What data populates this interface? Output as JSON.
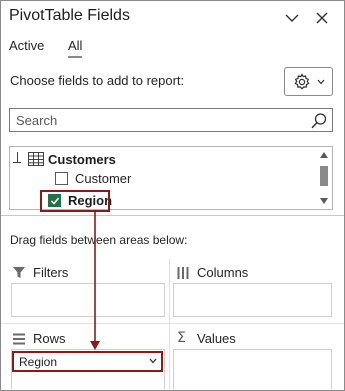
{
  "pane": {
    "title": "PivotTable Fields",
    "tabs": [
      {
        "label": "Active",
        "selected": false
      },
      {
        "label": "All",
        "selected": true
      }
    ],
    "choose_label": "Choose fields to add to report:",
    "search": {
      "placeholder": "Search",
      "value": ""
    },
    "field_list": {
      "table_name": "Customers",
      "fields": [
        {
          "label": "Customer",
          "checked": false
        },
        {
          "label": "Region",
          "checked": true
        }
      ]
    },
    "drag_label": "Drag fields between areas below:",
    "areas": {
      "filters": {
        "label": "Filters"
      },
      "columns": {
        "label": "Columns"
      },
      "rows": {
        "label": "Rows",
        "items": [
          {
            "label": "Region"
          }
        ]
      },
      "values": {
        "label": "Values"
      }
    }
  },
  "icons": {
    "collapse": "chevron-down-icon",
    "close": "close-icon",
    "tools": "gear-icon",
    "search": "search-icon",
    "table": "table-icon",
    "filter": "filter-icon",
    "columns": "columns-icon",
    "rows": "rows-icon",
    "values": "sigma-icon"
  },
  "colors": {
    "checkbox_checked": "#217346",
    "callout": "#8b1a1a",
    "border": "#8a8a8a"
  }
}
